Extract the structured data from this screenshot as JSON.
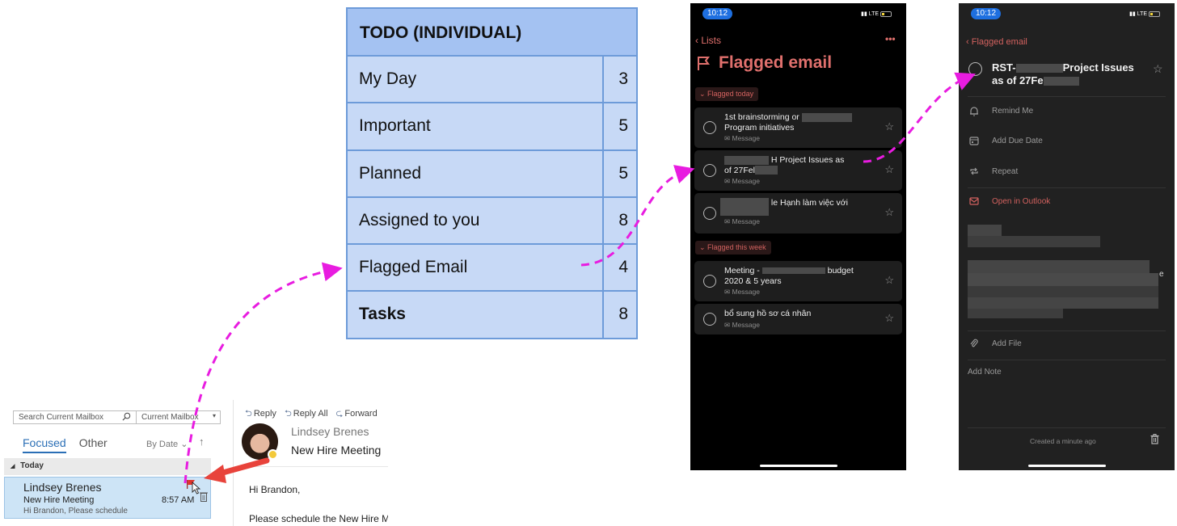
{
  "outlook": {
    "search_placeholder": "Search Current Mailbox",
    "scope": "Current Mailbox",
    "tabs": [
      "Focused",
      "Other"
    ],
    "sort_label": "By Date",
    "sort_chevron": "⌄",
    "sort_arrow": "↑",
    "group_label": "Today",
    "group_triangle": "◢",
    "mail": {
      "from": "Lindsey Brenes",
      "subject": "New Hire Meeting",
      "preview": "Hi Brandon,  Please schedule",
      "time": "8:57 AM",
      "flag_color": "#e0332b"
    }
  },
  "reading_pane": {
    "actions": [
      "Reply",
      "Reply All",
      "Forward"
    ],
    "sender": "Lindsey Brenes",
    "subject": "New Hire Meeting",
    "body_lines": [
      "Hi Brandon,",
      "Please schedule the New Hire Meeting"
    ]
  },
  "todo_table": {
    "title": "TODO (INDIVIDUAL)",
    "rows": [
      {
        "label": "My Day",
        "count": "3"
      },
      {
        "label": "Important",
        "count": "5"
      },
      {
        "label": "Planned",
        "count": "5"
      },
      {
        "label": "Assigned to you",
        "count": "8"
      },
      {
        "label": "Flagged Email",
        "count": "4"
      },
      {
        "label": "Tasks",
        "count": "8"
      }
    ],
    "header_color": "#a4c2f2",
    "row_color": "#c7d9f6",
    "border_color": "#6d9bd9"
  },
  "phone_list": {
    "time": "10:12",
    "network": "LTE",
    "back_label": "Lists",
    "more": "•••",
    "title": "Flagged email",
    "accent": "#e0706d",
    "groups": [
      {
        "label": "Flagged today",
        "items": [
          {
            "line1": "1st brainstorming or",
            "line2": "Program initiatives",
            "meta": "Message"
          },
          {
            "line1": "H Project Issues as",
            "line2": "of 27Fel",
            "meta": "Message"
          },
          {
            "line1": "le Hạnh làm việc với",
            "line2": "",
            "meta": "Message"
          }
        ]
      },
      {
        "label": "Flagged this week",
        "items": [
          {
            "line1": "Meeting -",
            "line1b": "budget",
            "line2": "2020 & 5 years",
            "meta": "Message"
          },
          {
            "line1": "bổ sung hồ sơ cá nhân",
            "line2": "",
            "meta": "Message"
          }
        ]
      }
    ]
  },
  "phone_detail": {
    "time": "10:12",
    "network": "LTE",
    "back_label": "Flagged email",
    "title_a": "RST-",
    "title_b": "Project Issues",
    "title_c": "as of 27Fe",
    "options": [
      "Remind Me",
      "Add Due Date",
      "Repeat",
      "Open in Outlook"
    ],
    "add_file": "Add File",
    "add_note": "Add Note",
    "created": "Created a minute ago",
    "stray_char": "e"
  },
  "annotations": {
    "arrow_color": "#e81ce0",
    "callout_arrow_color": "#e8433b"
  }
}
